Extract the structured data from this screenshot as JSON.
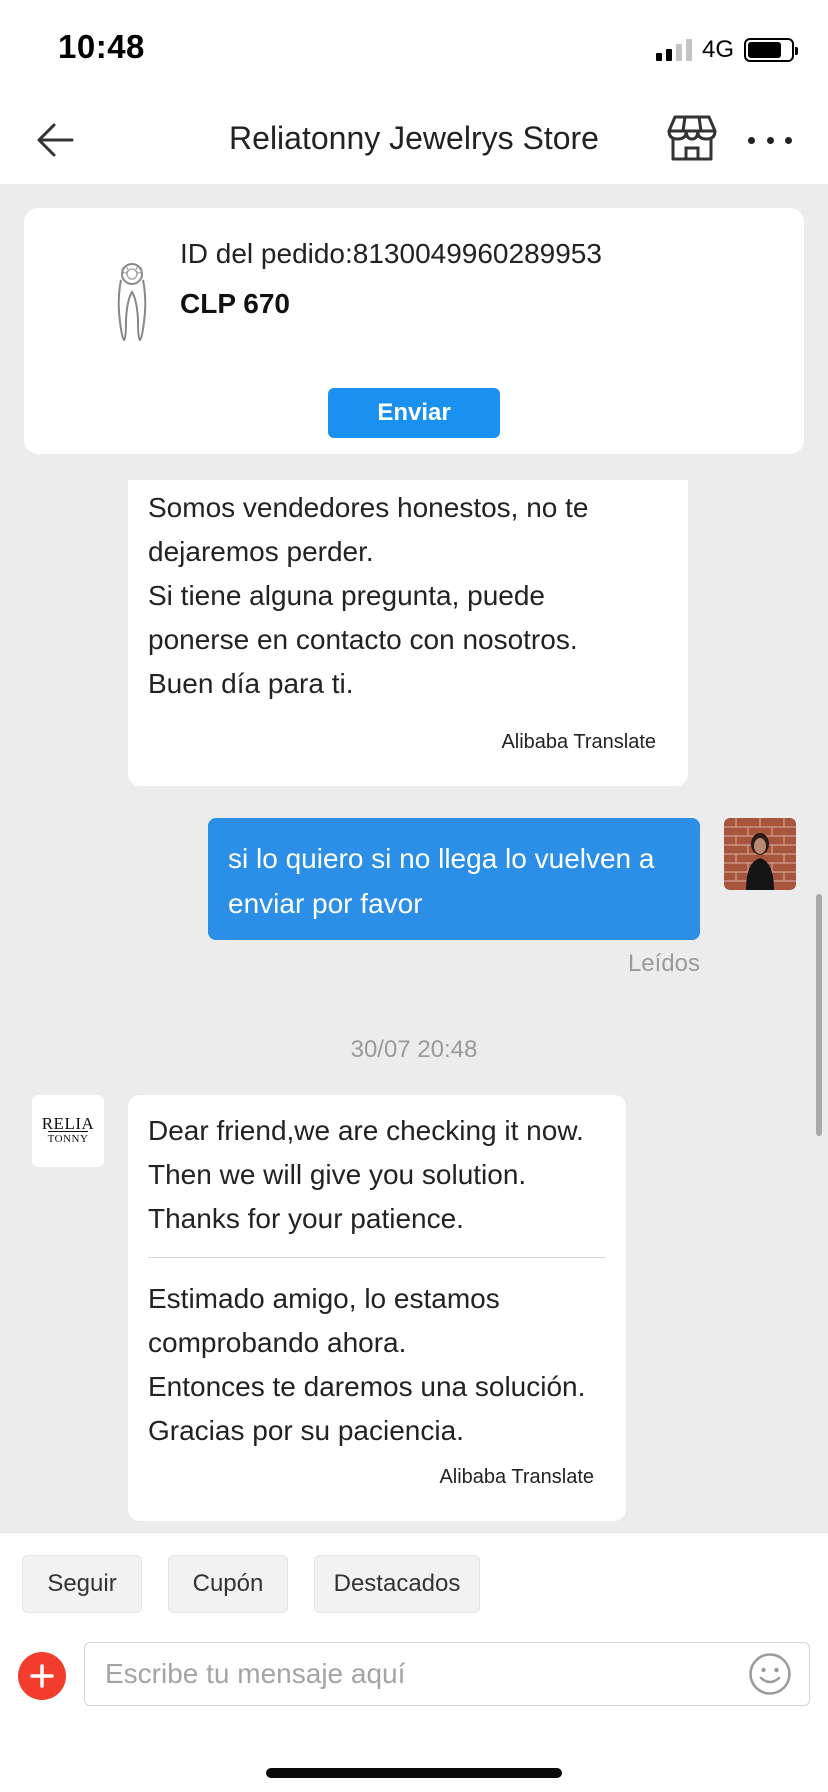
{
  "status_bar": {
    "time": "10:48",
    "network": "4G",
    "signal_bars_active": 2,
    "signal_bars_total": 4,
    "battery_level": 0.78
  },
  "nav": {
    "title": "Reliatonny Jewelrys Store",
    "icons": [
      "back-arrow-icon",
      "store-icon",
      "more-icon"
    ]
  },
  "order": {
    "id_text": "ID del pedido:8130049960289953",
    "price": "CLP 670",
    "send_label": "Enviar"
  },
  "messages": [
    {
      "sender": "store",
      "text": "enviar o te devolveremos el dinero.\nSomos vendedores honestos, no te\ndejaremos perder.\nSi tiene alguna pregunta, puede\nponerse en contacto con nosotros.\nBuen día para ti.",
      "translation_label": "Alibaba Translate"
    },
    {
      "sender": "user",
      "text": "si lo quiero si no llega lo vuelven a enviar por favor",
      "status": "Leídos"
    },
    {
      "timestamp": "30/07 20:48"
    },
    {
      "sender": "store",
      "avatar_text": [
        "RELIA",
        "TONNY"
      ],
      "text_original": "Dear friend,we are checking it now.\nThen we  will give you solution.\nThanks for your patience.",
      "text_translated": "Estimado amigo, lo estamos\ncomprobando ahora.\nEntonces te daremos una solución.\nGracias por su paciencia.",
      "translation_label": "Alibaba Translate"
    }
  ],
  "quick_actions": [
    "Seguir",
    "Cupón",
    "Destacados"
  ],
  "composer": {
    "placeholder": "Escribe tu mensaje aquí",
    "value": ""
  },
  "colors": {
    "accent_blue": "#1a91f0",
    "user_bubble": "#2b8fe8",
    "plus_button": "#f23c2c",
    "chat_background": "#ececec"
  }
}
